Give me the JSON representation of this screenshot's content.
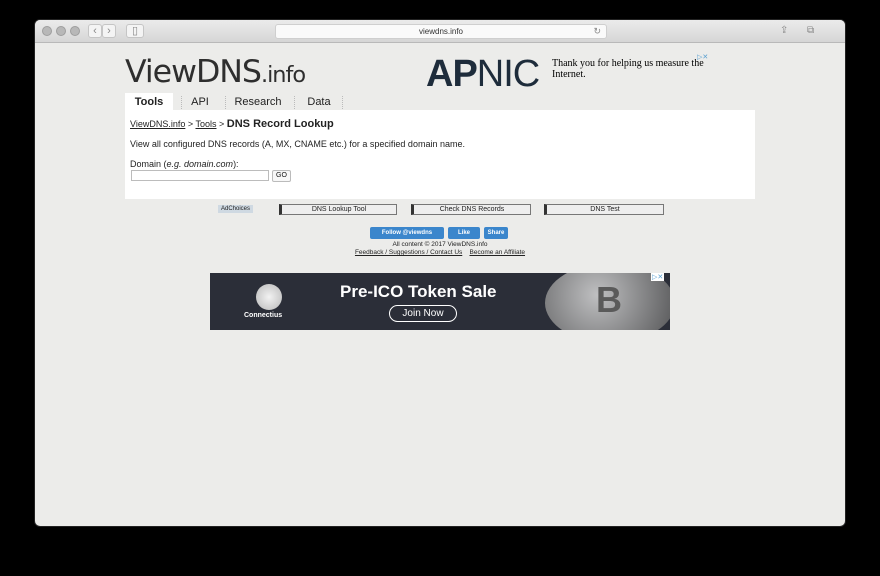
{
  "browser": {
    "url": "viewdns.info"
  },
  "header": {
    "logo_main": "ViewDNS",
    "logo_suffix": ".info",
    "ad_brand_ap": "AP",
    "ad_brand_nic": "NIC",
    "ad_text": "Thank you for helping us measure the Internet."
  },
  "tabs": [
    "Tools",
    "API",
    "Research",
    "Data"
  ],
  "breadcrumb": {
    "home": "ViewDNS.info",
    "sep1": ">",
    "tools": "Tools",
    "sep2": ">",
    "current": "DNS Record Lookup"
  },
  "main": {
    "description": "View all configured DNS records (A, MX, CNAME etc.) for a specified domain name.",
    "domain_label_prefix": "Domain (",
    "domain_label_example": "e.g. domain.com",
    "domain_label_suffix": "):",
    "domain_value": "",
    "go_label": "GO"
  },
  "ad_links": {
    "adchoices": "AdChoices",
    "items": [
      "DNS Lookup Tool",
      "Check DNS Records",
      "DNS Test"
    ]
  },
  "social": {
    "follow": "Follow @viewdns",
    "like": "Like",
    "share": "Share"
  },
  "footer": {
    "copyright": "All content © 2017 ViewDNS.info",
    "feedback": "Feedback / Suggestions / Contact Us",
    "affiliate": "Become an Affiliate"
  },
  "banner": {
    "brand": "Connectius",
    "title": "Pre-ICO Token Sale",
    "cta": "Join Now",
    "coin_glyph": "B"
  }
}
